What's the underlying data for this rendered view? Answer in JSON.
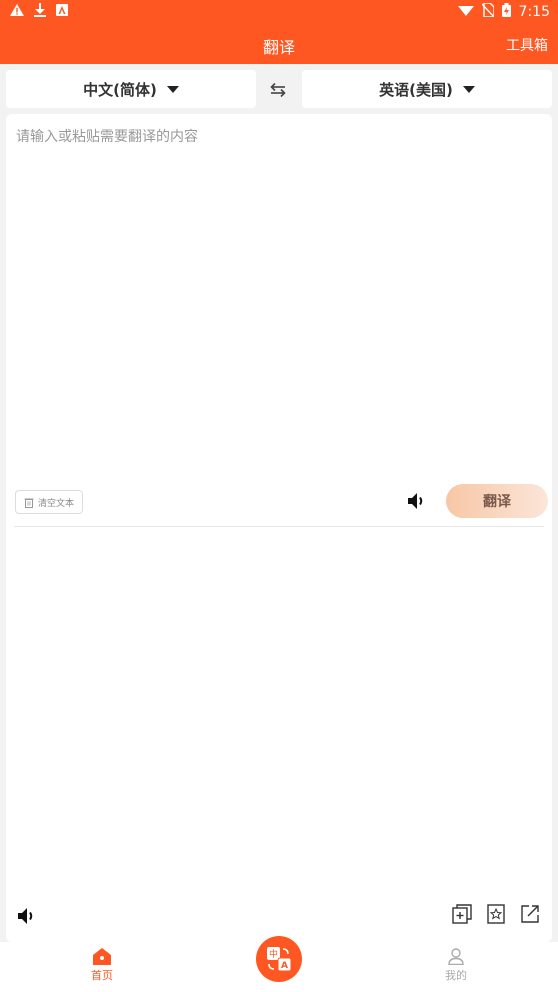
{
  "status_bar": {
    "time": "7:15",
    "icons_left": [
      "warning-icon",
      "download-icon",
      "a-box-icon"
    ],
    "icons_right": [
      "wifi-icon",
      "no-sim-icon",
      "battery-icon"
    ]
  },
  "app_bar": {
    "title": "翻译",
    "toolbox_label": "工具箱",
    "color": "#ff5722"
  },
  "languages": {
    "source": "中文(简体)",
    "target": "英语(美国)"
  },
  "input": {
    "placeholder": "请输入或粘贴需要翻译的内容",
    "value": ""
  },
  "controls": {
    "clear_label": "清空文本",
    "translate_label": "翻译"
  },
  "output": {
    "text": ""
  },
  "bottom_nav": {
    "home_label": "首页",
    "mine_label": "我的",
    "active_color": "#ff5722"
  }
}
